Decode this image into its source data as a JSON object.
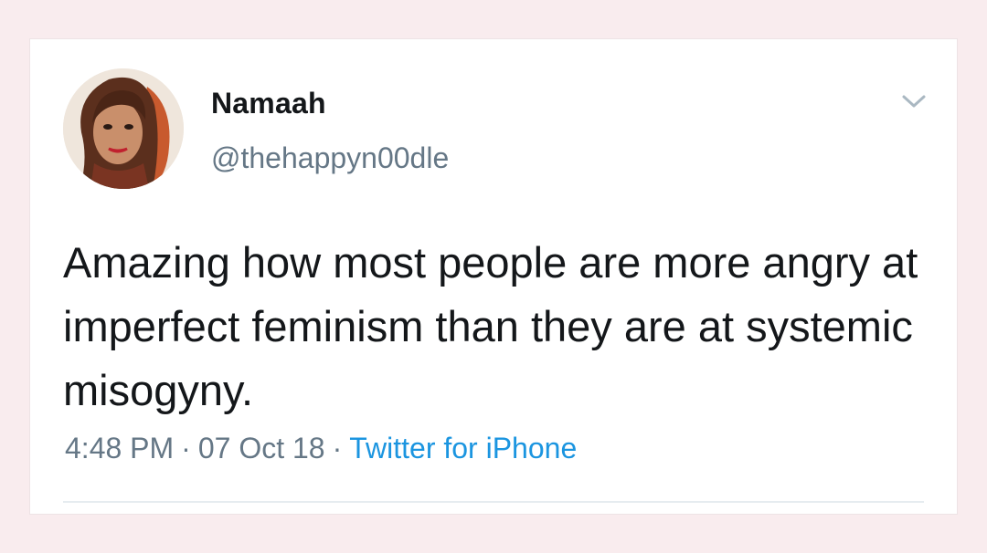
{
  "tweet": {
    "author": {
      "name": "Namaah",
      "handle": "@thehappyn00dle"
    },
    "text": "Amazing how most people are more angry at imperfect feminism than they are at systemic misogyny.",
    "time": "4:48 PM",
    "date": "07 Oct 18",
    "separator": "·",
    "source": "Twitter for iPhone"
  },
  "icons": {
    "menu": "chevron-down-icon",
    "avatar": "profile-photo"
  },
  "colors": {
    "page_background": "#f9ecee",
    "card_background": "#ffffff",
    "primary_text": "#14171a",
    "secondary_text": "#657786",
    "link": "#1b95e0"
  }
}
